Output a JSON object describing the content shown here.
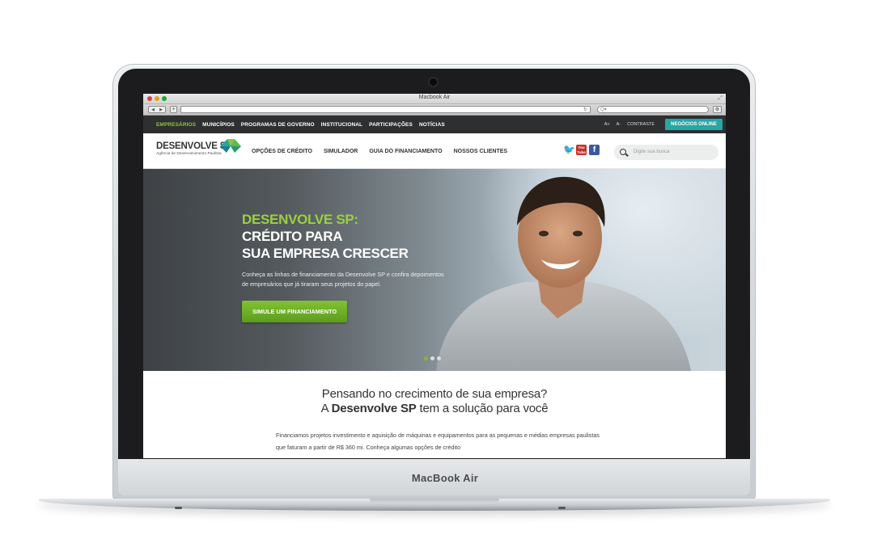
{
  "device": {
    "label": "MacBook Air"
  },
  "browser": {
    "window_title": "Macbook Air",
    "search_placeholder": "Q▾",
    "reload_glyph": "↻",
    "add_tab": "+",
    "back": "◀",
    "forward": "▶",
    "settings_glyph": "⚙",
    "resize_glyph": "⤢"
  },
  "topnav": {
    "links": [
      "EMPRESÁRIOS",
      "MUNICÍPIOS",
      "PROGRAMAS DE GOVERNO",
      "INSTITUCIONAL",
      "PARTICIPAÇÕES",
      "NOTÍCIAS"
    ],
    "font_up": "A+",
    "font_down": "A-",
    "contrast": "CONTRASTE",
    "cta": "NEGÓCIOS ONLINE"
  },
  "header": {
    "logo_text": "DESENVOLVE SP",
    "logo_sub": "Agência de Desenvolvimento Paulista",
    "nav": [
      "OPÇÕES DE CRÉDITO",
      "SIMULADOR",
      "GUIA DO FINANCIAMENTO",
      "NOSSOS CLIENTES"
    ],
    "youtube_label": "You Tube",
    "facebook_label": "f",
    "search_placeholder": "Digite sua busca"
  },
  "hero": {
    "title_green": "DESENVOLVE SP:",
    "title_line2": "CRÉDITO PARA",
    "title_line3": "SUA EMPRESA CRESCER",
    "paragraph": "Conheça as linhas de financiamento da Desenvolve SP e confira depoimentos de empresários que já tiraram seus projetos do papel.",
    "button": "SIMULE UM FINANCIAMENTO"
  },
  "section": {
    "title_line1": "Pensando no crecimento de sua empresa?",
    "title_line2_pre": "A ",
    "title_line2_bold": "Desenvolve SP",
    "title_line2_post": " tem a solução para você",
    "body": "Financiamos projetos investimento e aquisição de máquinas e equipamentos para as pequenas e médias empresas paulistas que faturam a partir de R$ 360 mi. Conheça algumas opções de crédito"
  },
  "colors": {
    "accent_green": "#8cc63f",
    "teal": "#27a6a7",
    "dark_bar": "#2e2f30"
  }
}
